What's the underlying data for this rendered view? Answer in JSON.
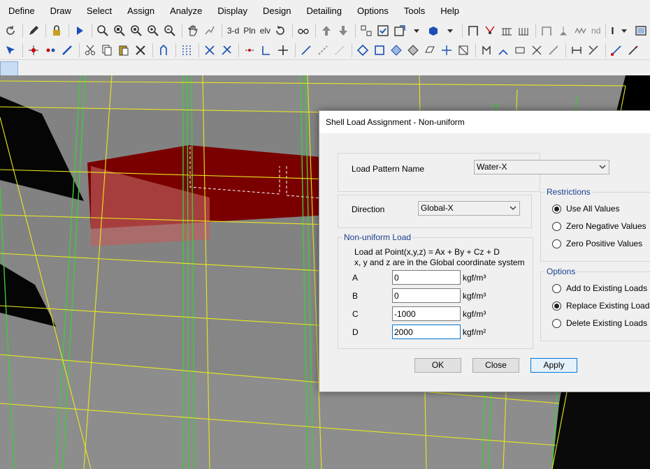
{
  "menubar": {
    "items": [
      "Define",
      "Draw",
      "Select",
      "Assign",
      "Analyze",
      "Display",
      "Design",
      "Detailing",
      "Options",
      "Tools",
      "Help"
    ]
  },
  "toolbar1": {
    "text_3d": "3-d",
    "text_pln": "Pln",
    "text_elv": "elv",
    "text_nd": "nd",
    "text_cursor": "I"
  },
  "dialog": {
    "title": "Shell Load Assignment -  Non-uniform",
    "load_pattern_label": "Load Pattern Name",
    "load_pattern_value": "Water-X",
    "direction_label": "Direction",
    "direction_value": "Global-X",
    "nonuniform": {
      "title": "Non-uniform Load",
      "formula": "Load at Point(x,y,z) = Ax + By + Cz + D",
      "coords_note": "x, y and z are in the Global coordinate system",
      "fields": [
        {
          "label": "A",
          "value": "0",
          "unit": "kgf/m³"
        },
        {
          "label": "B",
          "value": "0",
          "unit": "kgf/m³"
        },
        {
          "label": "C",
          "value": "-1000",
          "unit": "kgf/m³"
        },
        {
          "label": "D",
          "value": "2000",
          "unit": "kgf/m²"
        }
      ]
    },
    "restrictions": {
      "title": "Restrictions",
      "items": [
        {
          "label": "Use All Values",
          "selected": true
        },
        {
          "label": "Zero Negative Values",
          "selected": false
        },
        {
          "label": "Zero Positive Values",
          "selected": false
        }
      ]
    },
    "options": {
      "title": "Options",
      "items": [
        {
          "label": "Add to Existing Loads",
          "selected": false
        },
        {
          "label": "Replace Existing Loads",
          "selected": true
        },
        {
          "label": "Delete Existing Loads",
          "selected": false
        }
      ]
    },
    "buttons": {
      "ok": "OK",
      "close": "Close",
      "apply": "Apply"
    }
  },
  "colors": {
    "chrome": "#f0f0f0",
    "group_title": "#1a3f8f",
    "grid_yellow": "#e8e820",
    "column_green": "#3ccc3c",
    "slab_gray": "#9a9a9a",
    "wall_red": "#8b0000",
    "focus_blue": "#0078d7"
  }
}
